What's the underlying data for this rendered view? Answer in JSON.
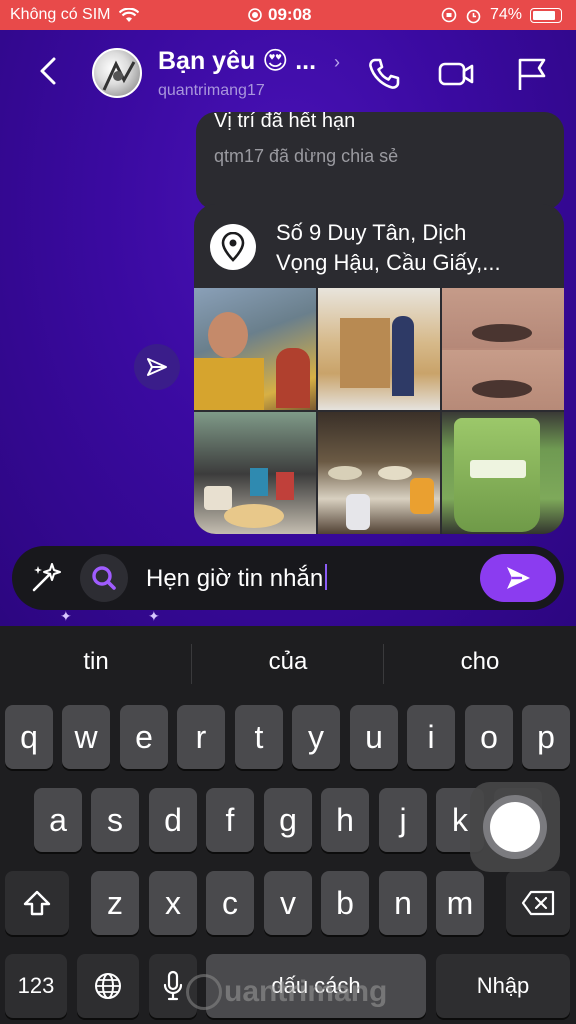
{
  "status_bar": {
    "carrier": "Không có SIM",
    "time": "09:08",
    "battery": "74%",
    "battery_level": 0.74
  },
  "header": {
    "name": "Bạn yêu 😍 ...",
    "username": "quantrimang17",
    "chevron": "›"
  },
  "messages": {
    "expired_title": "Vị trí đã hết hạn",
    "expired_sub": "qtm17 đã dừng chia sẻ",
    "location_line1": "Số 9 Duy Tân, Dịch",
    "location_line2": "Vọng Hậu, Cầu Giấy,..."
  },
  "composer": {
    "text": "Hẹn giờ tin nhắn"
  },
  "keyboard": {
    "suggestions": [
      "tin",
      "của",
      "cho"
    ],
    "row1": [
      "q",
      "w",
      "e",
      "r",
      "t",
      "y",
      "u",
      "i",
      "o",
      "p"
    ],
    "row2": [
      "a",
      "s",
      "d",
      "f",
      "g",
      "h",
      "j",
      "k",
      "l"
    ],
    "row3": [
      "z",
      "x",
      "c",
      "v",
      "b",
      "n",
      "m"
    ],
    "numbers_key": "123",
    "space_key": "dấu cách",
    "return_key": "Nhập"
  },
  "watermark": {
    "text": "uantrimang"
  },
  "colors": {
    "status_bar": "#e84a4a",
    "chat_bg": "#3a0aa0",
    "send_button": "#8b3cf0",
    "keyboard_bg": "#1e1e20"
  }
}
